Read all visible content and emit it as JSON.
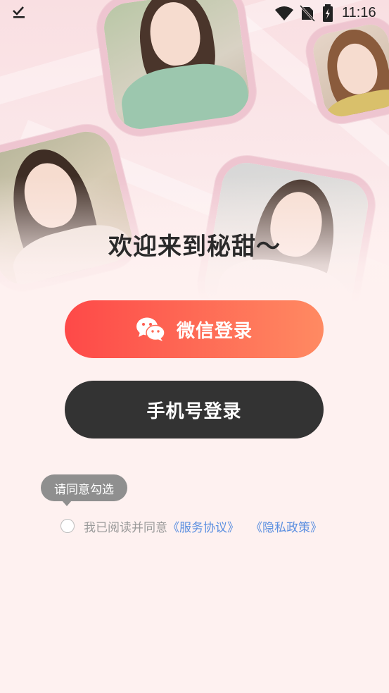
{
  "status_bar": {
    "time": "11:16",
    "icons": [
      "download-done-icon",
      "wifi-icon",
      "no-sim-icon",
      "battery-charging-icon"
    ]
  },
  "hero": {
    "photos": [
      "portrait-photo-green-top",
      "portrait-photo-smiling",
      "portrait-photo-outdoor",
      "portrait-photo-white-sweater"
    ]
  },
  "welcome_text": "欢迎来到秘甜～",
  "buttons": {
    "wechat_login": "微信登录",
    "phone_login": "手机号登录"
  },
  "tooltip": "请同意勾选",
  "agreement": {
    "prefix": "我已阅读并同意",
    "service_link": "《服务协议》",
    "privacy_link": "《隐私政策》",
    "checked": false
  },
  "colors": {
    "background": "#fef1f0",
    "wechat_gradient_start": "#fe4948",
    "wechat_gradient_end": "#ff8a62",
    "phone_button": "#333333",
    "link": "#5b8fe0"
  }
}
